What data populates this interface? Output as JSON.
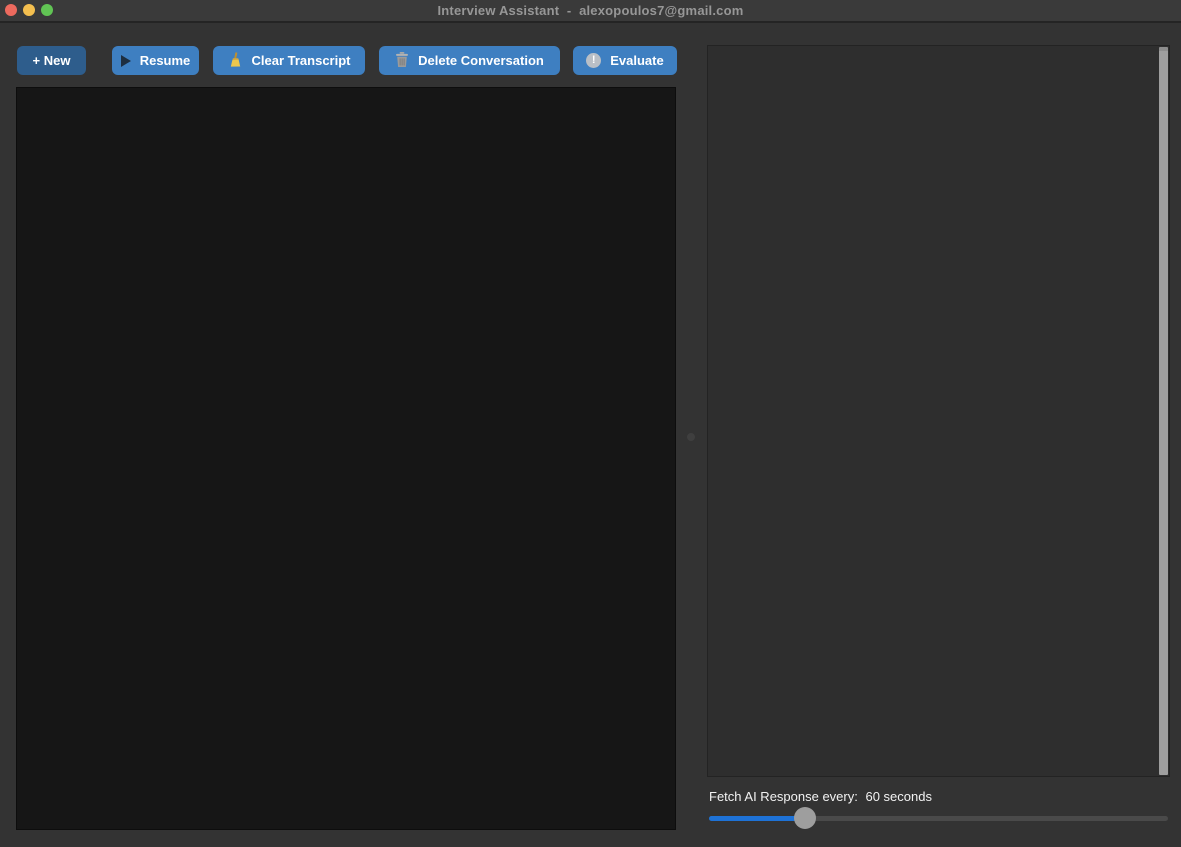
{
  "window": {
    "title": "Interview Assistant  -  alexopoulos7@gmail.com"
  },
  "toolbar": {
    "buttons": [
      {
        "label": "+ New",
        "icon": null,
        "style": "dark-blue"
      },
      {
        "label": "Resume",
        "icon": "play-icon",
        "style": "blue"
      },
      {
        "label": "Clear Transcript",
        "icon": "broom-icon",
        "style": "blue"
      },
      {
        "label": "Delete Conversation",
        "icon": "trash-icon",
        "style": "blue"
      },
      {
        "label": "Evaluate",
        "icon": "exclamation-icon",
        "style": "blue"
      }
    ]
  },
  "panels": {
    "transcript": {
      "content": ""
    },
    "ai_response": {
      "content": ""
    }
  },
  "settings": {
    "fetch_label": "Fetch AI Response every:",
    "fetch_value": "60 seconds",
    "slider_percent": 21
  },
  "icons": {
    "play-icon": "dark play triangle",
    "broom-icon": "yellow broom",
    "trash-icon": "gray trash can",
    "exclamation-icon": "gray circle with white exclamation mark",
    "close-icon": "red traffic light",
    "minimize-icon": "yellow traffic light",
    "zoom-icon": "green traffic light"
  },
  "colors": {
    "accent_blue": "#1e72d6",
    "button_blue": "#3e7fc1",
    "button_blue_dark": "#2e5d8c",
    "titlebar_bg": "#3a3a3a",
    "window_bg": "#333333",
    "transcript_panel_bg": "#161616",
    "response_panel_bg": "#2e2e2e",
    "traffic_red": "#ed6a5e",
    "traffic_yellow": "#f4bf4f",
    "traffic_green": "#61c454"
  }
}
